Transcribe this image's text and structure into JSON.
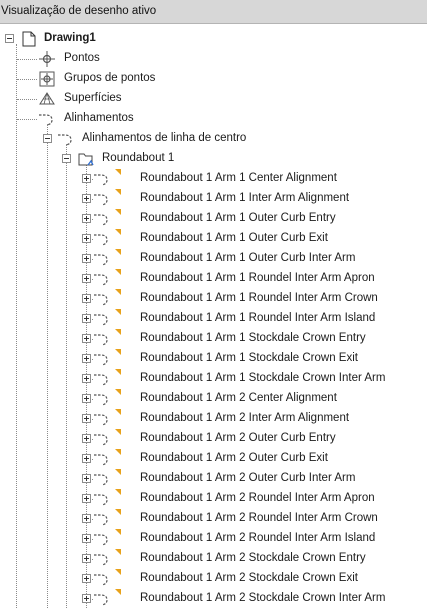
{
  "panel": {
    "title": "Visualização de desenho ativo"
  },
  "tree": {
    "root_label": "Drawing1",
    "categories": {
      "pontos": "Pontos",
      "grupos": "Grupos de pontos",
      "superficies": "Superfícies",
      "alinhamentos": "Alinhamentos"
    },
    "alinhamentos_centro": "Alinhamentos de linha de centro",
    "site_label": "Roundabout 1",
    "alignments": [
      "Roundabout 1 Arm 1 Center Alignment",
      "Roundabout 1 Arm 1 Inter Arm Alignment",
      "Roundabout 1 Arm 1 Outer Curb Entry",
      "Roundabout 1 Arm 1 Outer Curb Exit",
      "Roundabout 1 Arm 1 Outer Curb Inter Arm",
      "Roundabout 1 Arm 1 Roundel Inter Arm Apron",
      "Roundabout 1 Arm 1 Roundel Inter Arm Crown",
      "Roundabout 1 Arm 1 Roundel Inter Arm Island",
      "Roundabout 1 Arm 1 Stockdale Crown Entry",
      "Roundabout 1 Arm 1 Stockdale Crown Exit",
      "Roundabout 1 Arm 1 Stockdale Crown Inter Arm",
      "Roundabout 1 Arm 2 Center Alignment",
      "Roundabout 1 Arm 2 Inter Arm Alignment",
      "Roundabout 1 Arm 2 Outer Curb Entry",
      "Roundabout 1 Arm 2 Outer Curb Exit",
      "Roundabout 1 Arm 2 Outer Curb Inter Arm",
      "Roundabout 1 Arm 2 Roundel Inter Arm Apron",
      "Roundabout 1 Arm 2 Roundel Inter Arm Crown",
      "Roundabout 1 Arm 2 Roundel Inter Arm Island",
      "Roundabout 1 Arm 2 Stockdale Crown Entry",
      "Roundabout 1 Arm 2 Stockdale Crown Exit",
      "Roundabout 1 Arm 2 Stockdale Crown Inter Arm"
    ]
  },
  "colors": {
    "accent_flag": "#e8a21a",
    "header_bg": "#d7d7d7",
    "alignment_icon": "#2f6fd6"
  },
  "icons": {
    "drawing": "drawing-document-icon",
    "points": "points-icon",
    "point_groups": "point-groups-icon",
    "surfaces": "surface-icon",
    "alignments": "alignment-icon",
    "site": "site-folder-icon"
  }
}
